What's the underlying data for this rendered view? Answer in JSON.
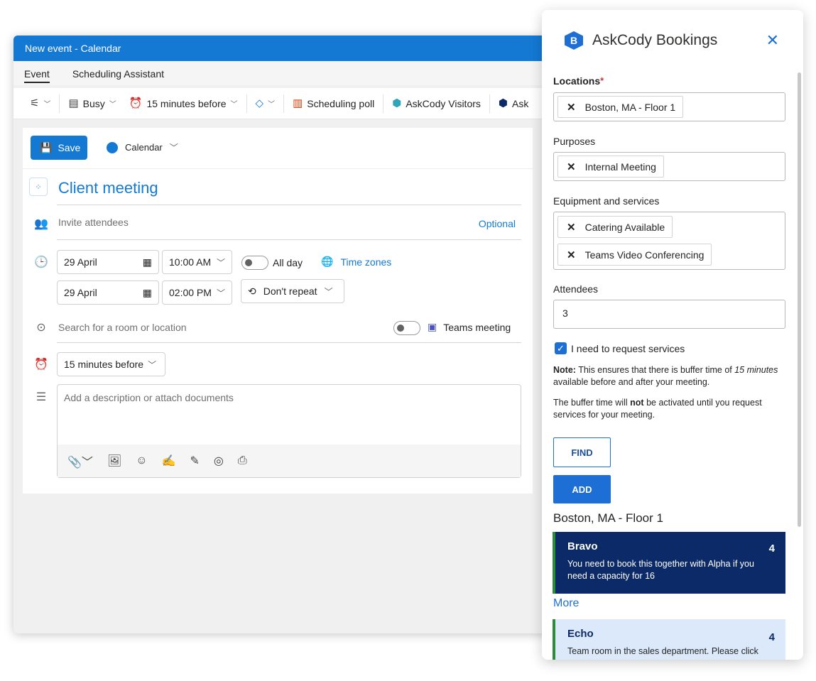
{
  "window": {
    "title": "New event - Calendar"
  },
  "tabs": [
    "Event",
    "Scheduling Assistant"
  ],
  "toolbar": {
    "show_as": "Busy",
    "reminder": "15 minutes before",
    "scheduling_poll": "Scheduling poll",
    "askcody_visitors": "AskCody Visitors",
    "askcody_truncated": "Ask"
  },
  "form": {
    "save_label": "Save",
    "calendar_label": "Calendar",
    "title": "Client meeting",
    "invite_placeholder": "Invite attendees",
    "optional_label": "Optional",
    "start_date": "29 April",
    "start_time": "10:00 AM",
    "all_day_label": "All day",
    "time_zones_label": "Time zones",
    "end_date": "29 April",
    "end_time": "02:00 PM",
    "repeat_label": "Don't repeat",
    "location_placeholder": "Search for a room or location",
    "teams_label": "Teams meeting",
    "reminder": "15 minutes before",
    "description_placeholder": "Add a description or attach documents"
  },
  "panel": {
    "title": "AskCody Bookings",
    "locations_label": "Locations",
    "required_mark": "*",
    "locations": [
      "Boston, MA - Floor 1"
    ],
    "purposes_label": "Purposes",
    "purposes": [
      "Internal Meeting"
    ],
    "equipment_label": "Equipment and services",
    "equipment": [
      "Catering Available",
      "Teams Video Conferencing"
    ],
    "attendees_label": "Attendees",
    "attendees_value": "3",
    "request_services_label": "I need to request services",
    "request_services_checked": true,
    "note_bold": "Note:",
    "note_text": " This ensures that there is buffer time of ",
    "note_italic": "15 minutes",
    "note_end": " available before and after your meeting.",
    "buffer_pre": "The buffer time will ",
    "buffer_bold": "not",
    "buffer_post": " be activated until you request services for your meeting.",
    "find_label": "FIND",
    "add_label": "ADD",
    "results_location": "Boston, MA - Floor 1",
    "rooms": [
      {
        "name": "Bravo",
        "capacity": "4",
        "description": "You need to book this together with Alpha if you need a capacity for 16"
      },
      {
        "name": "Echo",
        "capacity": "4",
        "description": "Team room in the sales department. Please click"
      }
    ],
    "more_label": "More"
  },
  "colors": {
    "outlook_blue": "#1479d3",
    "askcody_blue": "#1d6fd6",
    "room_selected_bg": "#0b2a67",
    "room_bg": "#dce9fb",
    "room_accent": "#2e8b3e"
  }
}
